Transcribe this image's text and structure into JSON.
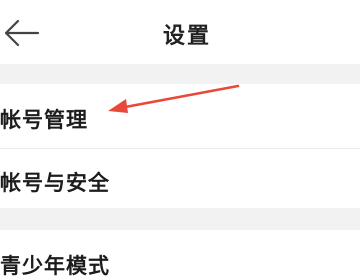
{
  "header": {
    "title": "设置",
    "back_icon": "arrow-left-icon"
  },
  "settings": {
    "items": [
      {
        "label": "帐号管理"
      },
      {
        "label": "帐号与安全"
      },
      {
        "label": "青少年模式"
      }
    ]
  },
  "annotation": {
    "icon": "red-arrow-icon",
    "color": "#e8493b"
  },
  "colors": {
    "section_gap": "#f2f2f2",
    "divider": "#e9e9e9"
  }
}
